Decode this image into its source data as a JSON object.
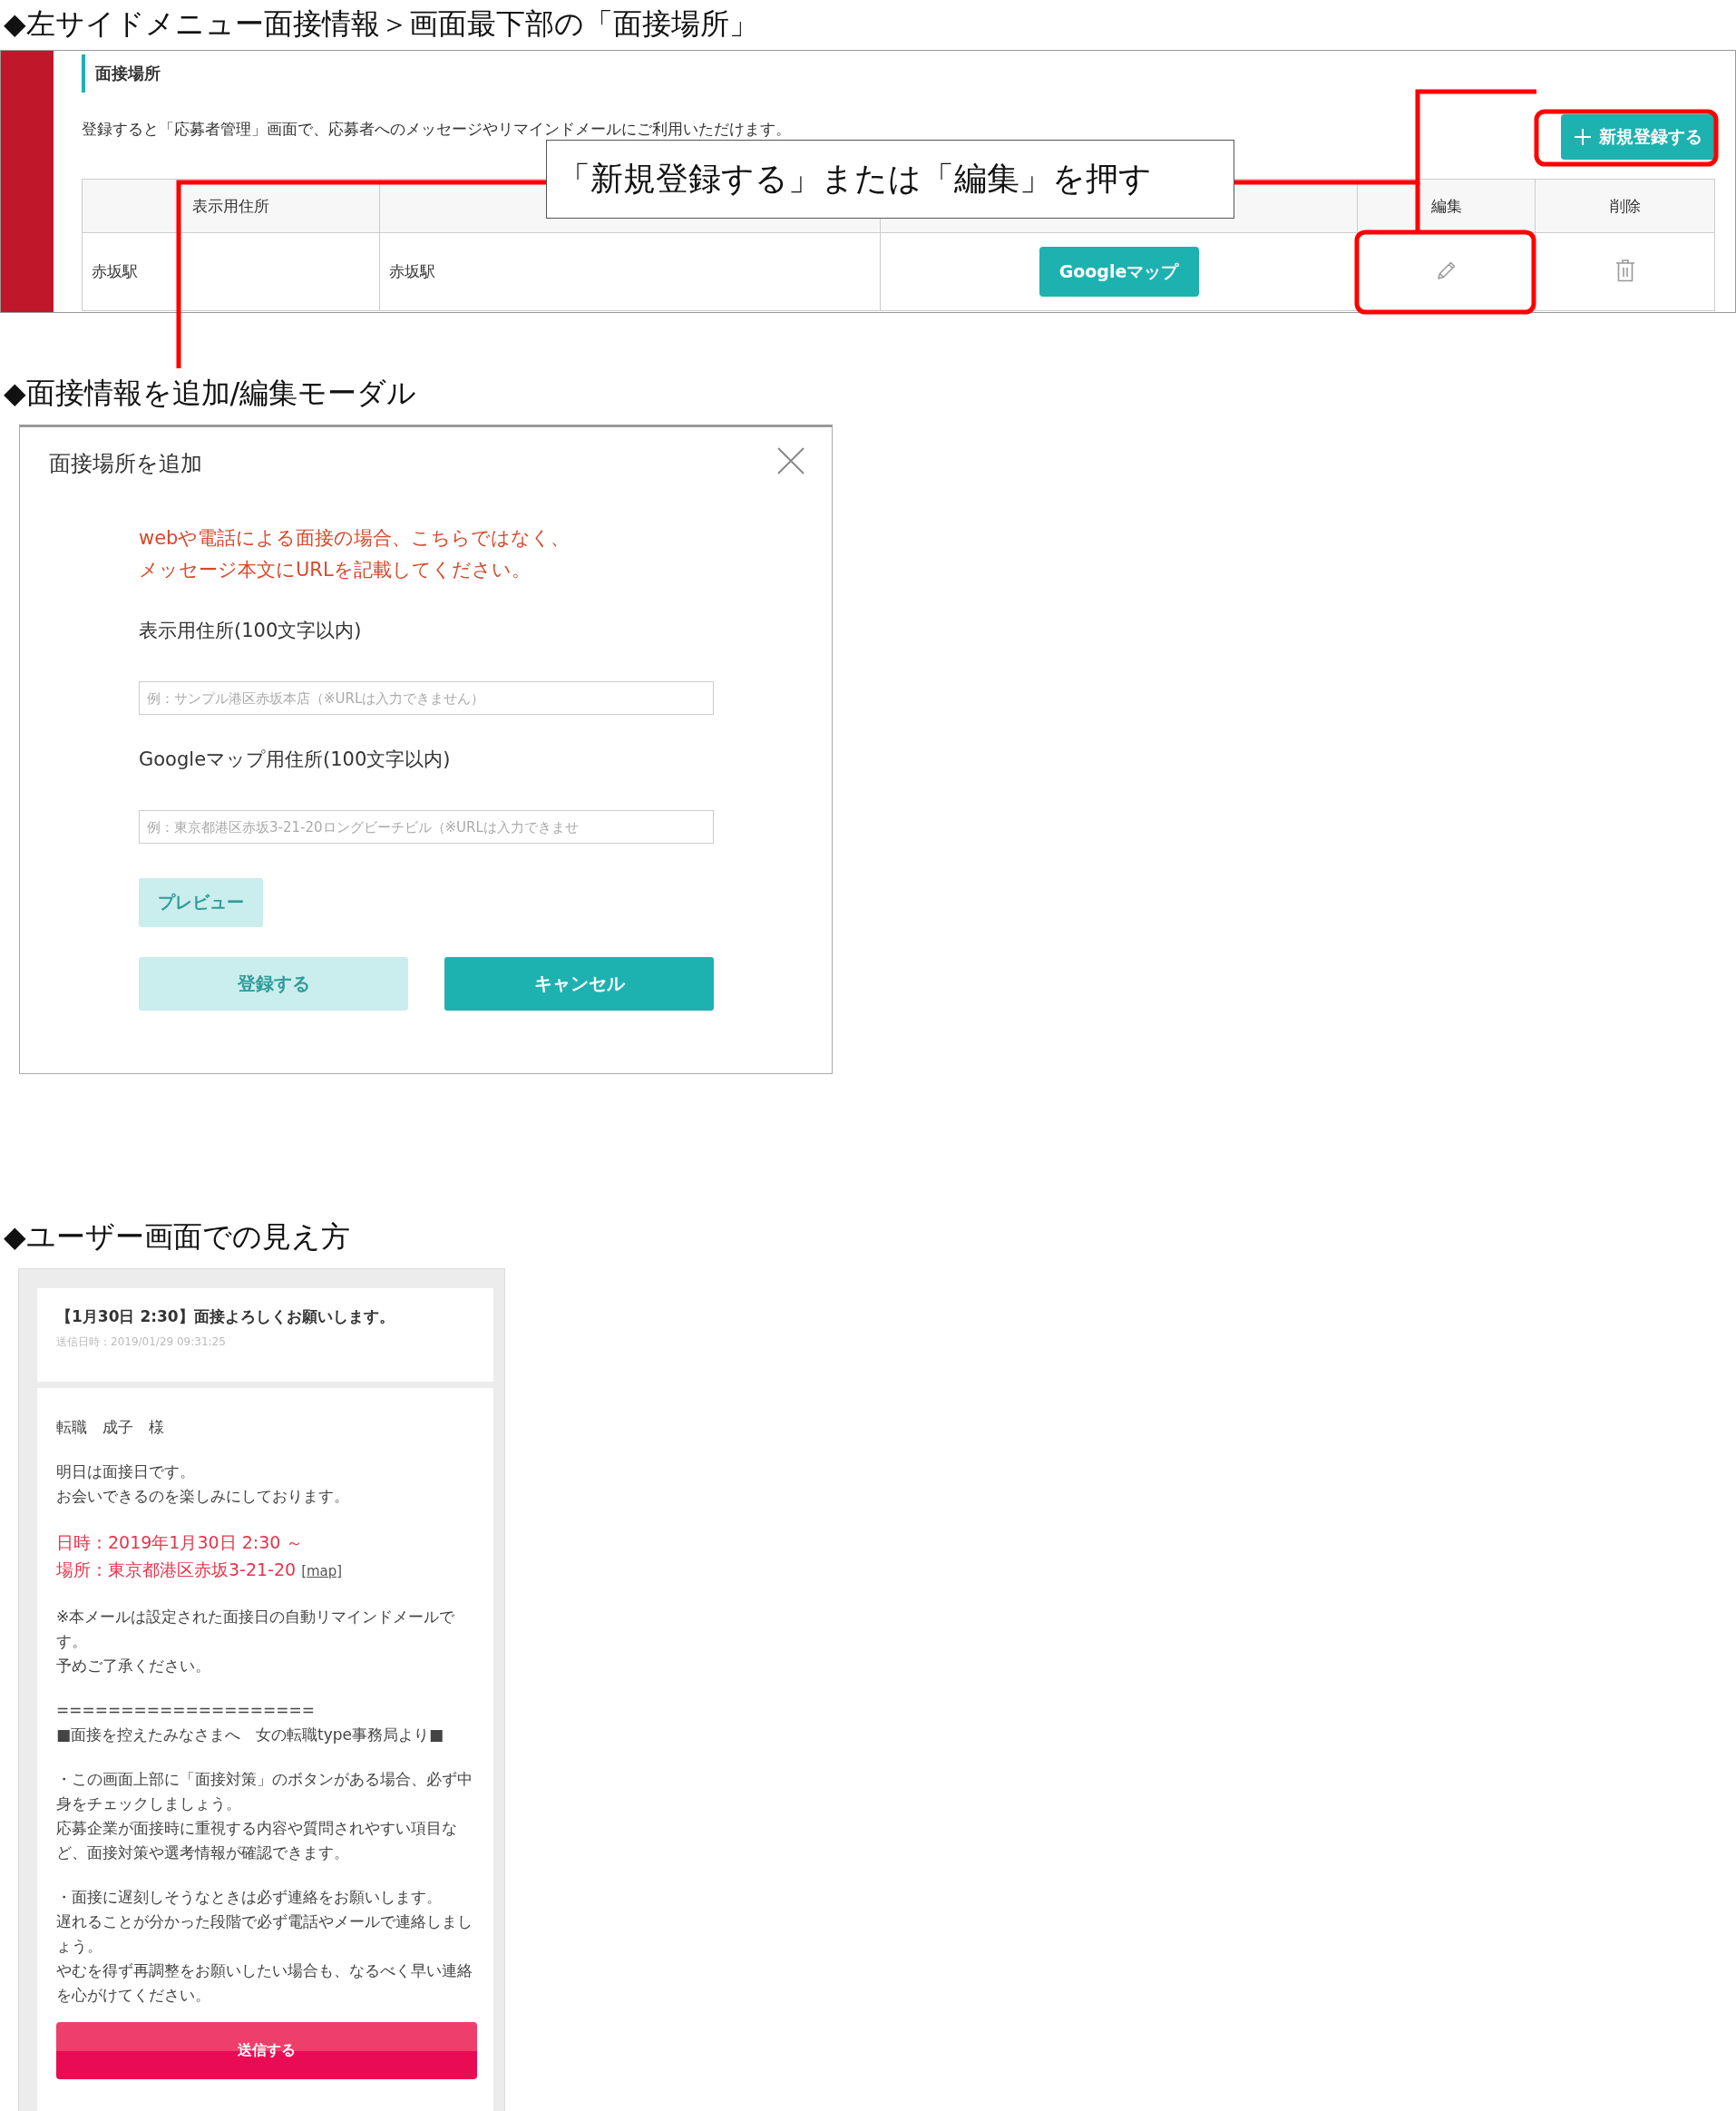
{
  "admin_section": {
    "heading": "◆左サイドメニュー面接情報＞画面最下部の「面接場所」",
    "panel": {
      "title": "面接場所",
      "description": "登録すると「応募者管理」画面で、応募者へのメッセージやリマインドメールにご利用いただけます。",
      "new_button": "新規登録する",
      "table": {
        "columns": [
          {
            "kind": "label",
            "label": "表示用住所"
          },
          {
            "kind": "blank"
          },
          {
            "kind": "blank"
          },
          {
            "kind": "label",
            "label": "編集"
          },
          {
            "kind": "label",
            "label": "削除"
          }
        ],
        "rows": [
          {
            "cells": [
              {
                "kind": "text",
                "text": "赤坂駅"
              },
              {
                "kind": "text",
                "text": "赤坂駅"
              },
              {
                "kind": "button",
                "text": "Googleマップ"
              },
              {
                "kind": "edit"
              },
              {
                "kind": "delete"
              }
            ]
          }
        ]
      }
    },
    "annotation": {
      "text": "「新規登録する」または「編集」を押す"
    }
  },
  "modal_section": {
    "heading": "◆面接情報を追加/編集モーダル",
    "modal": {
      "title": "面接場所を追加",
      "notice": [
        "webや電話による面接の場合、こちらではなく、",
        "メッセージ本文にURLを記載してください。"
      ],
      "fields": [
        {
          "label": "表示用住所(100文字以内)",
          "placeholder": "例：サンプル港区赤坂本店（※URLは入力できません）"
        },
        {
          "label": "Googleマップ用住所(100文字以内)",
          "placeholder": "例：東京都港区赤坂3-21-20ロングビーチビル（※URLは入力できませ"
        }
      ],
      "preview_button": {
        "label": "プレビュー",
        "disabled": true
      },
      "buttons": [
        {
          "label": "登録する",
          "disabled": true
        },
        {
          "label": "キャンセル",
          "disabled": false
        }
      ]
    }
  },
  "user_view_section": {
    "heading": "◆ユーザー画面での見え方",
    "message": {
      "subject": "【1月30日 2:30】面接よろしくお願いします。",
      "sent_at": "送信日時：2019/01/29 09:31:25",
      "blocks": [
        {
          "kind": "plain",
          "lines": [
            {
              "text": "転職　成子　様"
            }
          ]
        },
        {
          "kind": "plain",
          "lines": [
            {
              "text": "明日は面接日です。"
            },
            {
              "text": "お会いできるのを楽しみにしております。"
            }
          ]
        },
        {
          "kind": "highlight",
          "lines": [
            {
              "text": "日時：2019年1月30日 2:30 ～"
            },
            {
              "text": "場所：東京都港区赤坂3-21-20",
              "link": "[map]"
            }
          ]
        },
        {
          "kind": "plain",
          "lines": [
            {
              "text": "※本メールは設定された面接日の自動リマインドメールです。"
            },
            {
              "text": "予めご了承ください。"
            }
          ]
        },
        {
          "kind": "plain",
          "lines": [
            {
              "text": "===================="
            },
            {
              "text": "■面接を控えたみなさまへ　女の転職type事務局より■"
            }
          ]
        },
        {
          "kind": "plain",
          "lines": [
            {
              "text": "・この画面上部に「面接対策」のボタンがある場合、必ず中身をチェックしましょう。"
            },
            {
              "text": "応募企業が面接時に重視する内容や質問されやすい項目など、面接対策や選考情報が確認できます。"
            }
          ]
        },
        {
          "kind": "plain",
          "lines": [
            {
              "text": "・面接に遅刻しそうなときは必ず連絡をお願いします。"
            },
            {
              "text": "遅れることが分かった段階で必ず電話やメールで連絡しましょう。"
            },
            {
              "text": "やむを得ず再調整をお願いしたい場合も、なるべく早い連絡を心がけてください。"
            }
          ]
        }
      ],
      "send_button": "送信する"
    }
  }
}
